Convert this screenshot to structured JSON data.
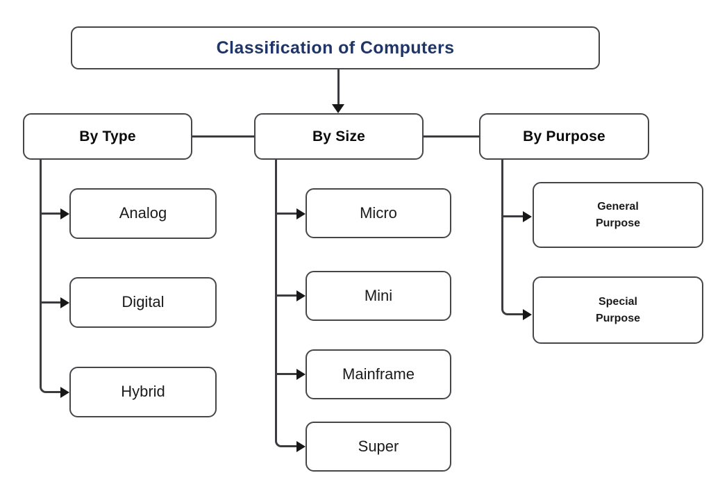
{
  "diagram": {
    "title": "Classification of Computers",
    "root": {
      "label": "Classification of Computers",
      "title_color": "#1f3568"
    },
    "branches": [
      {
        "id": "by-type",
        "label": "By Type",
        "children": [
          {
            "id": "analog",
            "label": "Analog"
          },
          {
            "id": "digital",
            "label": "Digital"
          },
          {
            "id": "hybrid",
            "label": "Hybrid"
          }
        ]
      },
      {
        "id": "by-size",
        "label": "By Size",
        "children": [
          {
            "id": "micro",
            "label": "Micro"
          },
          {
            "id": "mini",
            "label": "Mini"
          },
          {
            "id": "mainframe",
            "label": "Mainframe"
          },
          {
            "id": "super",
            "label": "Super"
          }
        ]
      },
      {
        "id": "by-purpose",
        "label": "By Purpose",
        "children": [
          {
            "id": "general-purpose",
            "label": "General\nPurpose"
          },
          {
            "id": "special-purpose",
            "label": "Special\nPurpose"
          }
        ]
      }
    ],
    "style": {
      "background": "#ffffff",
      "box_border": "#45454a",
      "connector": "#3c3c40",
      "arrow": "#171717",
      "leaf_text": "#1a1a1a",
      "category_text": "#0a0a0a"
    }
  }
}
